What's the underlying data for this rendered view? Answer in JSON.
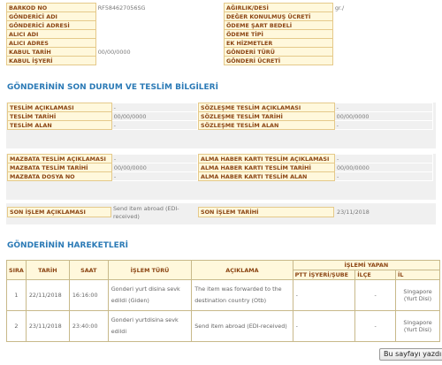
{
  "top": {
    "left_rows": [
      {
        "label": "BARKOD NO",
        "value": "RF584627056SG"
      },
      {
        "label": "GÖNDERİCİ ADI",
        "value": ""
      },
      {
        "label": "GÖNDERİCİ ADRESİ",
        "value": ""
      },
      {
        "label": "ALICI ADI",
        "value": ""
      },
      {
        "label": "ALICI ADRES",
        "value": ""
      },
      {
        "label": "KABUL TARİH",
        "value": "00/00/0000"
      },
      {
        "label": "KABUL İŞYERİ",
        "value": ""
      }
    ],
    "right_rows": [
      {
        "label": "AĞIRLIK/DESİ",
        "value": "gr./"
      },
      {
        "label": "DEĞER KONULMUŞ ÜCRETİ",
        "value": ""
      },
      {
        "label": "ÖDEME ŞART BEDELİ",
        "value": ""
      },
      {
        "label": "ÖDEME TİPİ",
        "value": ""
      },
      {
        "label": "EK HİZMETLER",
        "value": ""
      },
      {
        "label": "GÖNDERİ TÜRÜ",
        "value": ""
      },
      {
        "label": "GÖNDERİ ÜCRETİ",
        "value": ""
      }
    ]
  },
  "status_title": "GÖNDERİNİN SON DURUM VE TESLİM BİLGİLERİ",
  "teslim": {
    "left_rows": [
      {
        "label": "TESLİM AÇIKLAMASI",
        "value": "-"
      },
      {
        "label": "TESLİM TARİHİ",
        "value": "00/00/0000"
      },
      {
        "label": "TESLİM ALAN",
        "value": "-"
      }
    ],
    "right_rows": [
      {
        "label": "SÖZLEŞME TESLİM AÇIKLAMASI",
        "value": "-"
      },
      {
        "label": "SÖZLEŞME TESLİM TARİHİ",
        "value": "00/00/0000"
      },
      {
        "label": "SÖZLEŞME TESLİM ALAN",
        "value": "-"
      }
    ]
  },
  "mazbata": {
    "left_rows": [
      {
        "label": "MAZBATA TESLİM AÇIKLAMASI",
        "value": "-"
      },
      {
        "label": "MAZBATA TESLİM TARİHİ",
        "value": "00/00/0000"
      },
      {
        "label": "MAZBATA DOSYA NO",
        "value": "-"
      }
    ],
    "right_rows": [
      {
        "label": "ALMA HABER KARTI TESLİM AÇIKLAMASI",
        "value": "-"
      },
      {
        "label": "ALMA HABER KARTI TESLİM TARİHİ",
        "value": "00/00/0000"
      },
      {
        "label": "ALMA HABER KARTI TESLİM ALAN",
        "value": "-"
      }
    ]
  },
  "son_islem": {
    "aciklama_label": "SON İŞLEM AÇIKLAMASI",
    "aciklama_value": "Send item abroad (EDI-received)",
    "tarih_label": "SON İŞLEM TARİHİ",
    "tarih_value": "23/11/2018"
  },
  "movements_title": "GÖNDERİNİN HAREKETLERİ",
  "movements": {
    "headers": {
      "sira": "SIRA",
      "tarih": "TARİH",
      "saat": "SAAT",
      "islem_turu": "İŞLEM TÜRÜ",
      "aciklama": "AÇIKLAMA",
      "islemi_yapan": "İŞLEMİ YAPAN",
      "ptt": "PTT İŞYERİ/ŞUBE",
      "ilce": "İLÇE",
      "il": "İL"
    },
    "rows": [
      {
        "sira": "1",
        "tarih": "22/11/2018",
        "saat": "16:16:00",
        "islem_turu": "Gonderi yurt disina sevk edildi (Giden)",
        "aciklama": "The item was forwarded to the destination country (Otb)",
        "ptt": "-",
        "ilce": "-",
        "il": "Singapore (Yurt Disi)"
      },
      {
        "sira": "2",
        "tarih": "23/11/2018",
        "saat": "23:40:00",
        "islem_turu": "Gonderi yurtdisina sevk edildi",
        "aciklama": "Send item abroad (EDI-received)",
        "ptt": "-",
        "ilce": "-",
        "il": "Singapore (Yurt Disi)"
      }
    ]
  },
  "print_button": "Bu sayfayı yazdır"
}
